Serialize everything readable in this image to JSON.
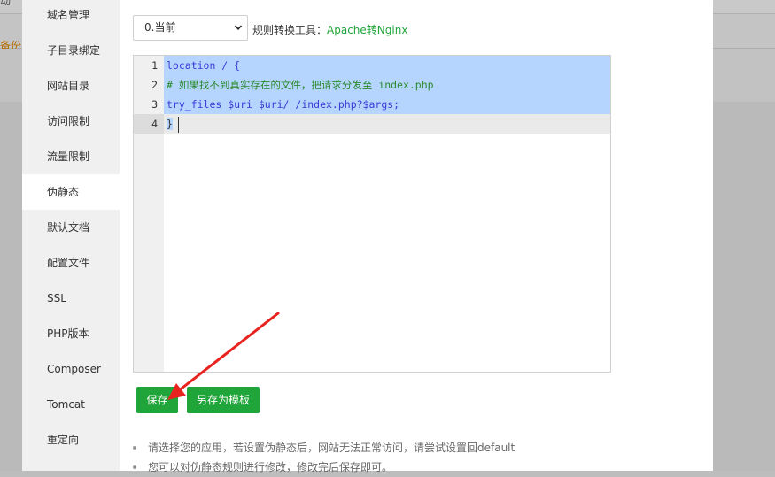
{
  "background": {
    "top_text": "动",
    "warning_text": "备份"
  },
  "sidebar": {
    "items": [
      {
        "label": "域名管理"
      },
      {
        "label": "子目录绑定"
      },
      {
        "label": "网站目录"
      },
      {
        "label": "访问限制"
      },
      {
        "label": "流量限制"
      },
      {
        "label": "伪静态"
      },
      {
        "label": "默认文档"
      },
      {
        "label": "配置文件"
      },
      {
        "label": "SSL"
      },
      {
        "label": "PHP版本"
      },
      {
        "label": "Composer"
      },
      {
        "label": "Tomcat"
      },
      {
        "label": "重定向"
      }
    ],
    "active_index": 5
  },
  "toolbar": {
    "version_value": "0.当前",
    "tool_label": "规则转换工具：",
    "tool_link": "Apache转Nginx"
  },
  "editor": {
    "lines": [
      {
        "num": "1",
        "text": "location / {"
      },
      {
        "num": "2",
        "text": "# 如果找不到真实存在的文件，把请求分发至 index.php"
      },
      {
        "num": "3",
        "text": "try_files $uri $uri/ /index.php?$args;"
      },
      {
        "num": "4",
        "text": "}"
      }
    ]
  },
  "actions": {
    "save_label": "保存",
    "save_template_label": "另存为模板"
  },
  "tips": [
    "请选择您的应用，若设置伪静态后，网站无法正常访问，请尝试设置回default",
    "您可以对伪静态规则进行修改，修改完后保存即可。"
  ],
  "colors": {
    "accent": "#20a53a",
    "selection": "#b5d5ff",
    "annotation_arrow": "#e8231f"
  }
}
